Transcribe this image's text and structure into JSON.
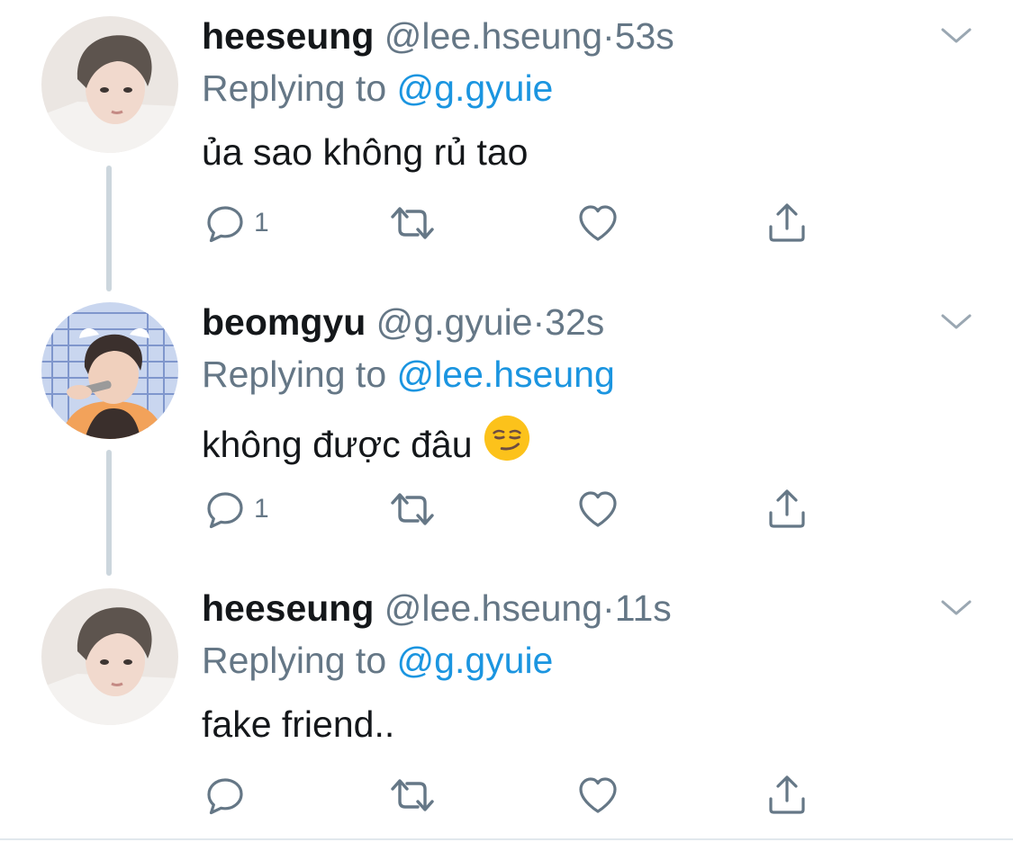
{
  "colors": {
    "text": "#14171a",
    "secondary": "#657786",
    "link": "#1b95e0",
    "thread_line": "#ccd6dd"
  },
  "tweets": [
    {
      "name": "heeseung",
      "handle": "@lee.hseung",
      "dot": "·",
      "time": "53s",
      "replying_prefix": "Replying to",
      "replying_to": "@g.gyuie",
      "text": "ủa sao không rủ tao",
      "reply_count": "1",
      "avatar": "heeseung-avatar",
      "icons": [
        "reply-icon",
        "retweet-icon",
        "like-icon",
        "share-icon",
        "chevron-down-icon"
      ]
    },
    {
      "name": "beomgyu",
      "handle": "@g.gyuie",
      "dot": "·",
      "time": "32s",
      "replying_prefix": "Replying to",
      "replying_to": "@lee.hseung",
      "text": "không được đâu",
      "emoji": "smirking-face-emoji",
      "reply_count": "1",
      "avatar": "beomgyu-avatar",
      "icons": [
        "reply-icon",
        "retweet-icon",
        "like-icon",
        "share-icon",
        "chevron-down-icon"
      ]
    },
    {
      "name": "heeseung",
      "handle": "@lee.hseung",
      "dot": "·",
      "time": "11s",
      "replying_prefix": "Replying to",
      "replying_to": "@g.gyuie",
      "text": "fake friend..",
      "reply_count": "",
      "avatar": "heeseung-avatar",
      "icons": [
        "reply-icon",
        "retweet-icon",
        "like-icon",
        "share-icon",
        "chevron-down-icon"
      ]
    }
  ]
}
